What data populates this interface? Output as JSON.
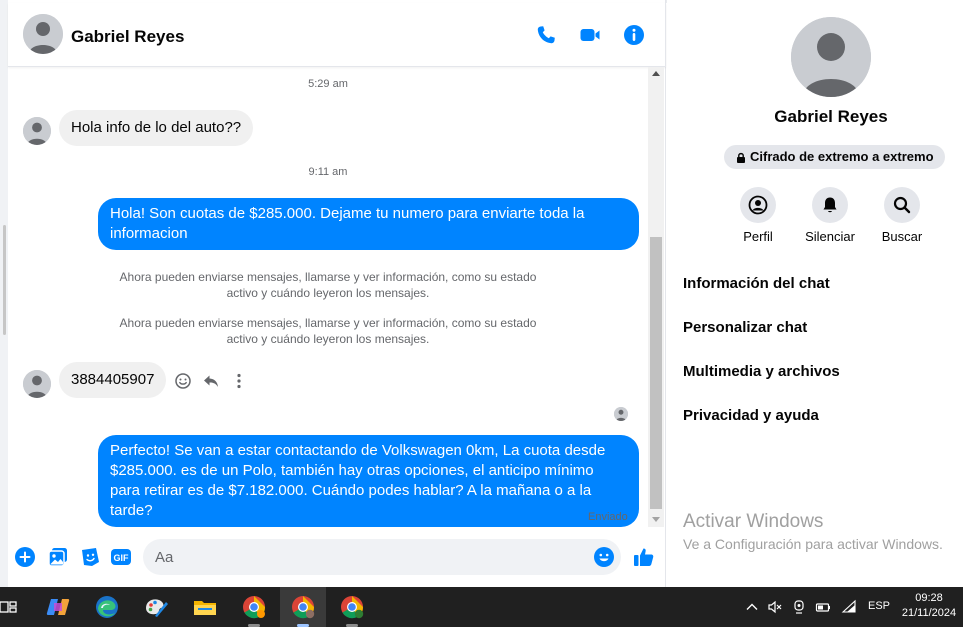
{
  "contact": {
    "name": "Gabriel Reyes"
  },
  "messages": {
    "timestamp_1": "5:29 am",
    "incoming_1": "Hola info de lo del auto??",
    "timestamp_2": "9:11 am",
    "outgoing_1": "Hola! Son cuotas de $285.000. Dejame tu numero para enviarte toda la informacion",
    "system_1": "Ahora pueden enviarse mensajes, llamarse y ver información, como su estado activo y cuándo leyeron los mensajes.",
    "system_2": "Ahora pueden enviarse mensajes, llamarse y ver información, como su estado activo y cuándo leyeron los mensajes.",
    "incoming_2": "3884405907",
    "outgoing_2": "Perfecto!  Se van a estar contactando de Volkswagen 0km, La cuota desde $285.000. es de un Polo, también hay otras opciones, el anticipo mínimo para retirar es de $7.182.000. Cuándo podes hablar? A la mañana o a la tarde?",
    "sent_status": "Enviado"
  },
  "composer": {
    "placeholder": "Aa",
    "gif_label": "GIF"
  },
  "info_panel": {
    "encryption_badge": "Cifrado de extremo a extremo",
    "actions": [
      {
        "label": "Perfil",
        "icon": "profile-icon"
      },
      {
        "label": "Silenciar",
        "icon": "bell-icon"
      },
      {
        "label": "Buscar",
        "icon": "search-icon"
      }
    ],
    "menu": [
      "Información del chat",
      "Personalizar chat",
      "Multimedia y archivos",
      "Privacidad y ayuda"
    ]
  },
  "watermark": {
    "title": "Activar Windows",
    "subtitle": "Ve a Configuración para activar Windows."
  },
  "taskbar": {
    "language": "ESP",
    "time": "09:28",
    "date": "21/11/2024"
  },
  "colors": {
    "accent": "#0084ff",
    "incoming_bubble": "#f0f0f0",
    "taskbar": "#202020"
  }
}
